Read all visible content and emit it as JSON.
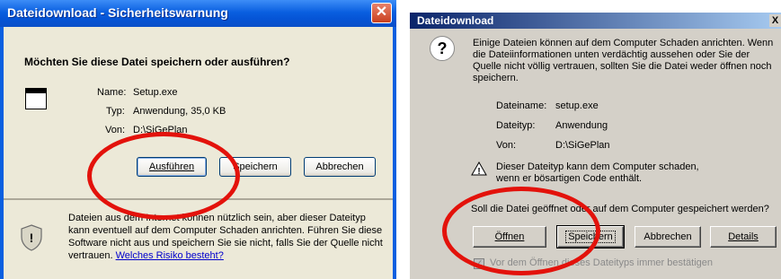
{
  "left_dialog": {
    "title": "Dateidownload - Sicherheitswarnung",
    "close_glyph": "✕",
    "question": "Möchten Sie diese Datei speichern oder ausführen?",
    "name_label": "Name:",
    "name_value": "Setup.exe",
    "type_label": "Typ:",
    "type_value": "Anwendung, 35,0 KB",
    "from_label": "Von:",
    "from_value": "D:\\SiGePlan",
    "buttons": {
      "run": "Ausführen",
      "save": "Speichern",
      "cancel": "Abbrechen"
    },
    "warning_text": "Dateien aus dem Internet können nützlich sein, aber dieser Dateityp kann eventuell auf dem Computer Schaden anrichten. Führen Sie diese Software nicht aus und speichern Sie sie nicht, falls Sie der Quelle nicht vertrauen.",
    "warning_link": "Welches Risiko besteht?"
  },
  "right_dialog": {
    "title": "Dateidownload",
    "close_glyph": "X",
    "intro": "Einige Dateien können auf dem Computer Schaden anrichten. Wenn die Dateiinformationen unten verdächtig aussehen oder Sie der Quelle nicht völlig vertrauen, sollten Sie die Datei weder öffnen noch speichern.",
    "filename_label": "Dateiname:",
    "filename_value": "setup.exe",
    "filetype_label": "Dateityp:",
    "filetype_value": "Anwendung",
    "from_label": "Von:",
    "from_value": "D:\\SiGePlan",
    "danger_text": "Dieser Dateityp kann dem Computer schaden, wenn er bösartigen Code enthält.",
    "prompt": "Soll die Datei geöffnet oder auf dem Computer gespeichert werden?",
    "buttons": {
      "open": "Öffnen",
      "save": "Speichern",
      "cancel": "Abbrechen",
      "details": "Details"
    },
    "checkbox_label": "Vor dem Öffnen dieses Dateityps immer bestätigen",
    "checkbox_checked": true
  },
  "annotations": {
    "ellipse_color": "#e3120b"
  }
}
